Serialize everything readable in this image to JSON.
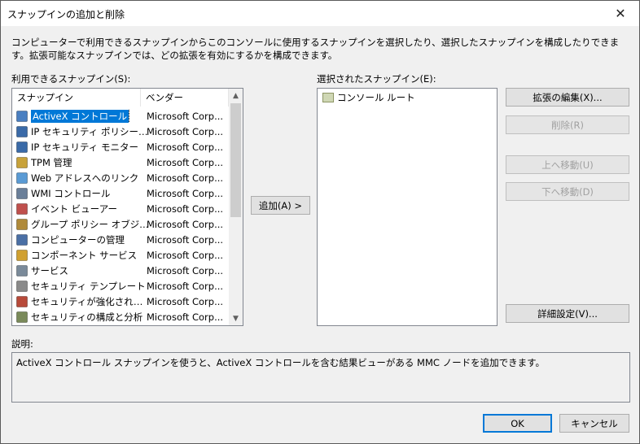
{
  "window": {
    "title": "スナップインの追加と削除",
    "close_glyph": "✕"
  },
  "description": "コンピューターで利用できるスナップインからこのコンソールに使用するスナップインを選択したり、選択したスナップインを構成したりできます。拡張可能なスナップインでは、どの拡張を有効にするかを構成できます。",
  "available": {
    "label": "利用できるスナップイン(S):",
    "col_name": "スナップイン",
    "col_vendor": "ベンダー",
    "items": [
      {
        "name": "ActiveX コントロール",
        "vendor": "Microsoft Corp...",
        "icon": "activex-icon",
        "selected": true
      },
      {
        "name": "IP セキュリティ ポリシーの管...",
        "vendor": "Microsoft Corp...",
        "icon": "ip-security-icon"
      },
      {
        "name": "IP セキュリティ モニター",
        "vendor": "Microsoft Corp...",
        "icon": "ip-monitor-icon"
      },
      {
        "name": "TPM 管理",
        "vendor": "Microsoft Corp...",
        "icon": "tpm-icon"
      },
      {
        "name": "Web アドレスへのリンク",
        "vendor": "Microsoft Corp...",
        "icon": "web-link-icon"
      },
      {
        "name": "WMI コントロール",
        "vendor": "Microsoft Corp...",
        "icon": "wmi-icon"
      },
      {
        "name": "イベント ビューアー",
        "vendor": "Microsoft Corp...",
        "icon": "event-viewer-icon"
      },
      {
        "name": "グループ ポリシー オブジェク...",
        "vendor": "Microsoft Corp...",
        "icon": "group-policy-icon"
      },
      {
        "name": "コンピューターの管理",
        "vendor": "Microsoft Corp...",
        "icon": "computer-management-icon"
      },
      {
        "name": "コンポーネント サービス",
        "vendor": "Microsoft Corp...",
        "icon": "component-services-icon"
      },
      {
        "name": "サービス",
        "vendor": "Microsoft Corp...",
        "icon": "services-icon"
      },
      {
        "name": "セキュリティ テンプレート",
        "vendor": "Microsoft Corp...",
        "icon": "security-template-icon"
      },
      {
        "name": "セキュリティが強化された ...",
        "vendor": "Microsoft Corp...",
        "icon": "firewall-icon"
      },
      {
        "name": "セキュリティの構成と分析",
        "vendor": "Microsoft Corp...",
        "icon": "security-analysis-icon"
      }
    ]
  },
  "add_button": "追加(A) >",
  "selected": {
    "label": "選択されたスナップイン(E):",
    "items": [
      {
        "name": "コンソール ルート",
        "icon": "folder-icon"
      }
    ]
  },
  "buttons": {
    "edit_extensions": "拡張の編集(X)...",
    "remove": "削除(R)",
    "move_up": "上へ移動(U)",
    "move_down": "下へ移動(D)",
    "advanced": "詳細設定(V)...",
    "ok": "OK",
    "cancel": "キャンセル"
  },
  "explanation": {
    "label": "説明:",
    "text": "ActiveX コントロール スナップインを使うと、ActiveX コントロールを含む結果ビューがある MMC ノードを追加できます。"
  }
}
